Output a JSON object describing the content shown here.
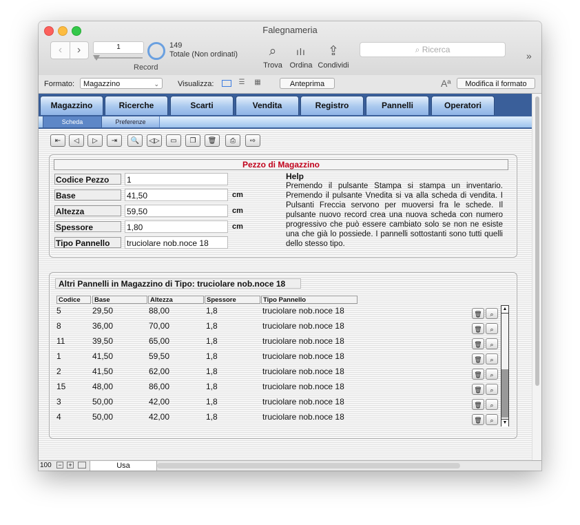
{
  "window": {
    "title": "Falegnameria"
  },
  "toolbar": {
    "record_value": "1",
    "record_label": "Record",
    "record_count": "149",
    "record_total": "Totale (Non ordinati)",
    "find_label": "Trova",
    "sort_label": "Ordina",
    "share_label": "Condividi",
    "search_placeholder": "Ricerca",
    "more": "»"
  },
  "format_bar": {
    "format_label": "Formato:",
    "format_value": "Magazzino",
    "view_label": "Visualizza:",
    "preview_button": "Anteprima",
    "text_size_icon": "Aª",
    "edit_layout_button": "Modifica il formato"
  },
  "tabs": [
    "Magazzino",
    "Ricerche",
    "Scarti",
    "Vendita",
    "Registro",
    "Pannelli",
    "Operatori"
  ],
  "subtabs": [
    "Scheda",
    "Preferenze"
  ],
  "record_nav_icons": [
    "⇤",
    "◁",
    "▷",
    "⇥",
    "🔍",
    "◁▷",
    "▭",
    "❐",
    "🗑",
    "⎙",
    "⇨"
  ],
  "form": {
    "title": "Pezzo di Magazzino",
    "fields": [
      {
        "label": "Codice Pezzo",
        "value": "1",
        "unit": ""
      },
      {
        "label": "Base",
        "value": "41,50",
        "unit": "cm"
      },
      {
        "label": "Altezza",
        "value": "59,50",
        "unit": "cm"
      },
      {
        "label": "Spessore",
        "value": "1,80",
        "unit": "cm"
      },
      {
        "label": "Tipo Pannello",
        "value": "truciolare nob.noce 18",
        "unit": ""
      }
    ],
    "help_title": "Help",
    "help_text": "Premendo il pulsante Stampa si stampa un inventario. Premendo il pulsante Vnedita si va alla scheda di vendita. I Pulsanti Freccia servono per muoversi fra le schede. Il pulsante nuovo record crea una nuova scheda con numero progressivo che può essere cambiato solo se non ne esiste una che già lo possiede. I pannelli sottostanti sono tutti quelli dello stesso tipo."
  },
  "related": {
    "title_prefix": "Altri Pannelli in Magazzino di Tipo:",
    "title_value": "truciolare nob.noce 18",
    "columns": [
      "Codice",
      "Base",
      "Altezza",
      "Spessore",
      "Tipo Pannello"
    ],
    "rows": [
      [
        "5",
        "29,50",
        "88,00",
        "1,8",
        "truciolare nob.noce 18"
      ],
      [
        "8",
        "36,00",
        "70,00",
        "1,8",
        "truciolare nob.noce 18"
      ],
      [
        "11",
        "39,50",
        "65,00",
        "1,8",
        "truciolare nob.noce 18"
      ],
      [
        "1",
        "41,50",
        "59,50",
        "1,8",
        "truciolare nob.noce 18"
      ],
      [
        "2",
        "41,50",
        "62,00",
        "1,8",
        "truciolare nob.noce 18"
      ],
      [
        "15",
        "48,00",
        "86,00",
        "1,8",
        "truciolare nob.noce 18"
      ],
      [
        "3",
        "50,00",
        "42,00",
        "1,8",
        "truciolare nob.noce 18"
      ],
      [
        "4",
        "50,00",
        "42,00",
        "1,8",
        "truciolare nob.noce 18"
      ]
    ]
  },
  "status": {
    "zoom": "100",
    "mode": "Usa"
  }
}
